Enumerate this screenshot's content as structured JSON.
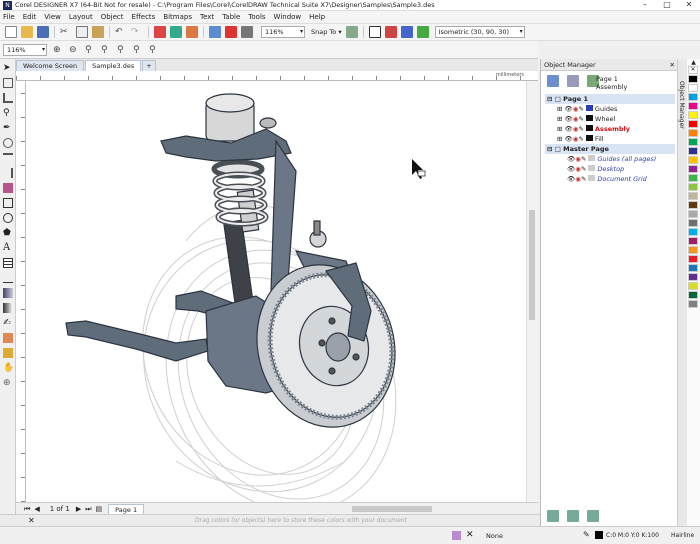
{
  "window": {
    "title": "Corel DESIGNER X7 (64-Bit Not for resale) - C:\\Program Files\\Corel\\CorelDRAW Technical Suite X7\\Designer\\Samples\\Sample3.des"
  },
  "menu": [
    "File",
    "Edit",
    "View",
    "Layout",
    "Object",
    "Effects",
    "Bitmaps",
    "Text",
    "Table",
    "Tools",
    "Window",
    "Help"
  ],
  "toolbar": {
    "zoom": "116%",
    "snap": "Snap To",
    "projection": "Isometric (30, 90, 30)"
  },
  "propbar": {
    "zoom": "116%"
  },
  "tabs": [
    {
      "label": "Welcome Screen"
    },
    {
      "label": "Sample3.des"
    }
  ],
  "ruler": {
    "unit": "millimeters"
  },
  "pagenav": {
    "count": "1 of 1",
    "page": "Page 1"
  },
  "palette": {
    "hint": "Drag colors (or objects) here to store these colors with your document"
  },
  "status": {
    "fill": "None",
    "outline_color": "C:0 M:0 Y:0 K:100",
    "outline_width": "Hairline"
  },
  "docker": {
    "title": "Object Manager",
    "tab_label": "Object Manager",
    "page": "Page 1",
    "layer": "Assembly",
    "page1": "Page 1",
    "layers1": [
      {
        "name": "Guides",
        "color": "#2a3fb0",
        "label_color": "#222"
      },
      {
        "name": "Wheel",
        "color": "#111",
        "label_color": "#222"
      },
      {
        "name": "Assembly",
        "color": "#111",
        "label_color": "#cc1111"
      },
      {
        "name": "Fill",
        "color": "#111",
        "label_color": "#222"
      }
    ],
    "master": "Master Page",
    "layers2": [
      {
        "name": "Guides (all pages)",
        "label_color": "#2a3fb0"
      },
      {
        "name": "Desktop",
        "label_color": "#2a3fb0"
      },
      {
        "name": "Document Grid",
        "label_color": "#2a3fb0"
      }
    ]
  },
  "colors": [
    "#000000",
    "#ffffff",
    "#00a0e3",
    "#ec008c",
    "#fff200",
    "#ff0000",
    "#ff8000",
    "#00a651",
    "#2e3192",
    "#ffc000",
    "#92278f",
    "#39b54a",
    "#8dc63f",
    "#c2b59b",
    "#603913",
    "#a7a9ac",
    "#6d6e71",
    "#00aeef",
    "#9e1f63",
    "#f7941d",
    "#ed1c24",
    "#1c75bc",
    "#662d91",
    "#d7df23",
    "#006838",
    "#808080"
  ]
}
